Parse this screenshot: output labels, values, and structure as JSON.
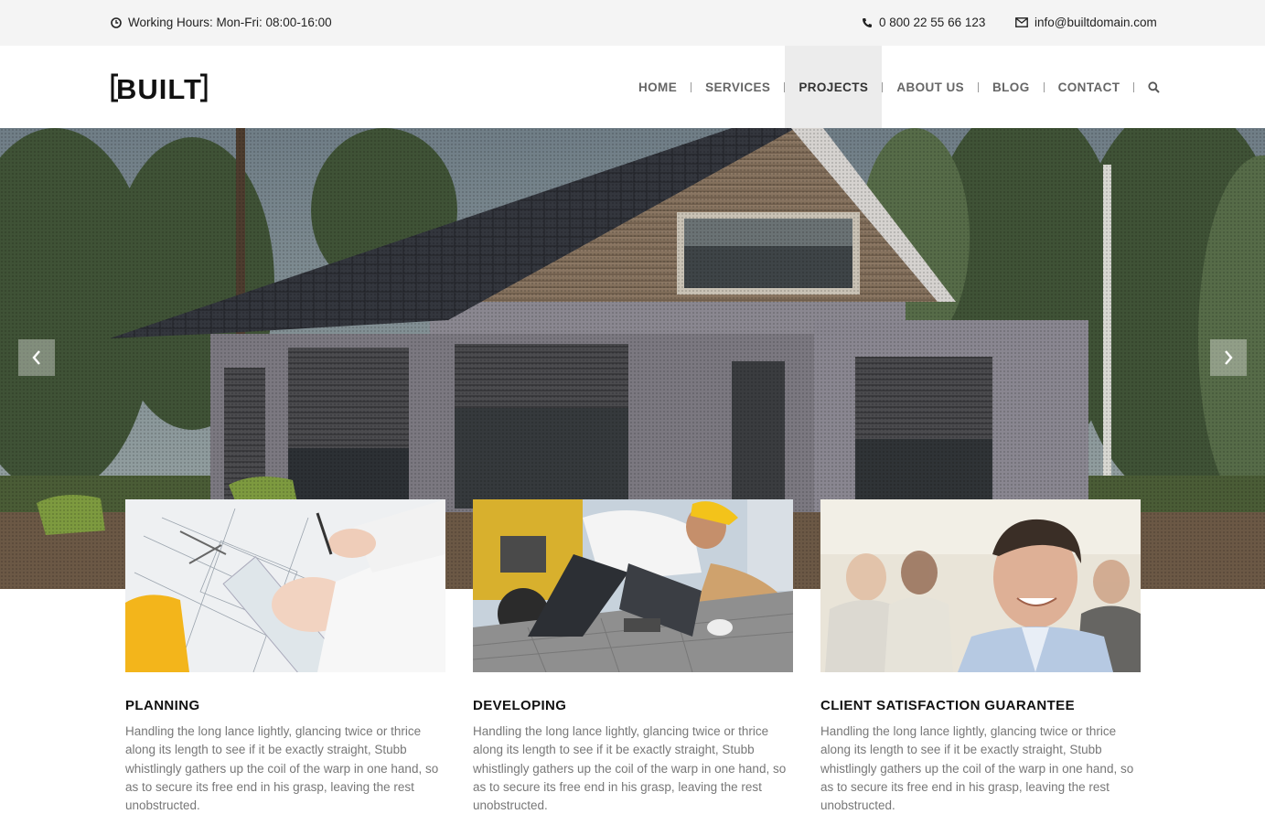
{
  "topbar": {
    "hours": "Working Hours: Mon-Fri: 08:00-16:00",
    "phone": "0 800 22 55 66 123",
    "email": "info@builtdomain.com",
    "icons": [
      "clock-icon",
      "phone-icon",
      "envelope-icon"
    ]
  },
  "header": {
    "logo_text": "BUILT",
    "nav": [
      {
        "label": "HOME"
      },
      {
        "label": "SERVICES"
      },
      {
        "label": "PROJECTS",
        "active": true
      },
      {
        "label": "ABOUT US"
      },
      {
        "label": "BLOG"
      },
      {
        "label": "CONTACT"
      }
    ],
    "search_icon": "search-icon"
  },
  "hero": {
    "prev_icon": "chevron-left-icon",
    "next_icon": "chevron-right-icon"
  },
  "cards": [
    {
      "title": "PLANNING",
      "text": "Handling the long lance lightly, glancing twice or thrice along its length to see if it be exactly straight, Stubb whistlingly gathers up the coil of the warp in one hand, so as to secure its free end in his grasp, leaving the rest unobstructed."
    },
    {
      "title": "DEVELOPING",
      "text": "Handling the long lance lightly, glancing twice or thrice along its length to see if it be exactly straight, Stubb whistlingly gathers up the coil of the warp in one hand, so as to secure its free end in his grasp, leaving the rest unobstructed."
    },
    {
      "title": "CLIENT SATISFACTION GUARANTEE",
      "text": "Handling the long lance lightly, glancing twice or thrice along its length to see if it be exactly straight, Stubb whistlingly gathers up the coil of the warp in one hand, so as to secure its free end in his grasp, leaving the rest unobstructed."
    }
  ],
  "colors": {
    "topbar_bg": "#f4f4f4",
    "nav_active_bg": "#ececec",
    "nav_text": "#666666",
    "body_text": "#777777",
    "heading_text": "#111111"
  }
}
